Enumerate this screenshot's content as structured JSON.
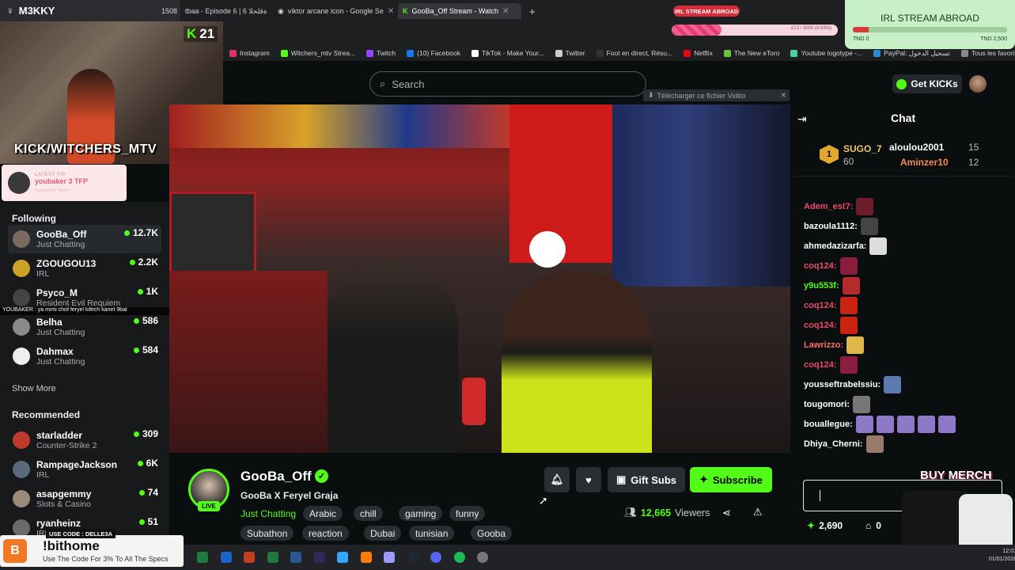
{
  "app": {
    "title": "M3KKY",
    "tab_count": "1508"
  },
  "tabs": [
    {
      "label": "tbaa - Episode 6 | 6 ةقلحلا"
    },
    {
      "label": "viktor arcane icon - Google Se"
    },
    {
      "label": "GooBa_Off Stream - Watch"
    }
  ],
  "irl": {
    "badge": "IRL STREAM ABROAD",
    "progress_text": "£13 / 3000 (9.63%)",
    "box_title": "IRL STREAM ABROAD",
    "left": "TND 0",
    "right": "TND 2,500",
    "progress_fraction": 0.3,
    "box_fraction": 0.1
  },
  "bookmarks": [
    {
      "label": "Instagram",
      "color": "#e1306c"
    },
    {
      "label": "Witchers_mtv Strea...",
      "color": "#53fc18"
    },
    {
      "label": "Twitch",
      "color": "#9146ff"
    },
    {
      "label": "(10) Facebook",
      "color": "#1877f2"
    },
    {
      "label": "TikTok - Make Your...",
      "color": "#ffffff"
    },
    {
      "label": "Twitter",
      "color": "#cccccc"
    },
    {
      "label": "Foot en direct, Résu...",
      "color": "#333333"
    },
    {
      "label": "Netflix",
      "color": "#e50914"
    },
    {
      "label": "The New eToro",
      "color": "#69c53e"
    },
    {
      "label": "Youtube logotype -...",
      "color": "#4ad29a"
    },
    {
      "label": "PayPal: تسجيل الدخول",
      "color": "#2c8bd6"
    },
    {
      "label": "Tous les favoris",
      "color": "#888888"
    }
  ],
  "webcam": {
    "overlay_text": "KICK/WITCHERS_MTV",
    "kick_count": "21"
  },
  "tip": {
    "label": "LATEST TIP",
    "value": "youbaker 3 TFP",
    "small": "Powered by Tipeee"
  },
  "ticker": {
    "text": "YOUBAKER : ya mimi chof feryel kifech kanet 9bal"
  },
  "search": {
    "placeholder": "Search"
  },
  "header": {
    "get_kicks": "Get KICKs"
  },
  "download_bar": {
    "label": "Télécharger ce fichier Vidéo"
  },
  "sidebar": {
    "following_label": "Following",
    "following": [
      {
        "name": "GooBa_Off",
        "category": "Just Chatting",
        "viewers": "12.7K",
        "avatar": "#7a6a60"
      },
      {
        "name": "ZGOUGOU13",
        "category": "IRL",
        "viewers": "2.2K",
        "avatar": "#c9a227"
      },
      {
        "name": "Psyco_M",
        "category": "Resident Evil Requiem",
        "viewers": "1K",
        "avatar": "#444444"
      },
      {
        "name": "Belha",
        "category": "Just Chatting",
        "viewers": "586",
        "avatar": "#8a8a8a"
      },
      {
        "name": "Dahmax",
        "category": "Just Chatting",
        "viewers": "584",
        "avatar": "#eeeeee"
      }
    ],
    "show_more": "Show More",
    "recommended_label": "Recommended",
    "recommended": [
      {
        "name": "starladder",
        "category": "Counter-Strike 2",
        "viewers": "309",
        "avatar": "#c0392b"
      },
      {
        "name": "RampageJackson",
        "category": "IRL",
        "viewers": "6K",
        "avatar": "#5a6a7a"
      },
      {
        "name": "asapgemmy",
        "category": "Slots & Casino",
        "viewers": "74",
        "avatar": "#9a8a7a"
      },
      {
        "name": "ryanheinz",
        "category": "IRL",
        "viewers": "51",
        "avatar": "#6a6a6a"
      }
    ]
  },
  "stream": {
    "name": "GooBa_Off",
    "live": "LIVE",
    "title": "GooBa X Feryel Graja",
    "category": "Just Chatting",
    "tags_row1": [
      "Arabic",
      "chill",
      "gaming",
      "funny"
    ],
    "tags_row2": [
      "Subathon",
      "reaction",
      "Dubai",
      "tunisian",
      "Gooba"
    ],
    "gift_subs": "Gift Subs",
    "subscribe": "Subscribe",
    "viewers": "12,665",
    "viewers_label": "Viewers"
  },
  "chat": {
    "title": "Chat",
    "leaders": [
      {
        "name": "SUGO_7",
        "value": "60"
      },
      {
        "name": "aloulou2001",
        "value": "15"
      },
      {
        "name": "Aminzer10",
        "value": "12"
      }
    ],
    "messages": [
      {
        "user": "Adem_est7:",
        "color": "#e94b6a"
      },
      {
        "user": "bazoula1112:",
        "color": "#ffffff"
      },
      {
        "user": "ahmedazizarfa:",
        "color": "#ffffff"
      },
      {
        "user": "coq124:",
        "color": "#e94b6a"
      },
      {
        "user": "y9u553f:",
        "color": "#53fc18"
      },
      {
        "user": "coq124:",
        "color": "#e94b6a"
      },
      {
        "user": "coq124:",
        "color": "#e94b6a"
      },
      {
        "user": "Lawrizzo:",
        "color": "#ff6b6b"
      },
      {
        "user": "coq124:",
        "color": "#e94b6a"
      },
      {
        "user": "yousseftrabelssiu:",
        "color": "#ffffff"
      },
      {
        "user": "tougomori:",
        "color": "#ffffff"
      },
      {
        "user": "bouallegue:",
        "color": "#ffffff"
      },
      {
        "user": "Dhiya_Cherni:",
        "color": "#ffffff"
      }
    ],
    "points": "2,690",
    "points2": "0",
    "merch": "BUY MERCH"
  },
  "promo": {
    "code": "USE CODE : DELLE3A",
    "name": "!bithome",
    "sub": "Use The Code For 3% To All The Specs",
    "logo": "B"
  },
  "clock": {
    "time": "12:01",
    "date": "01/01/2026"
  },
  "colors": {
    "accent": "#53fc18",
    "bg": "#0b0e0f",
    "panel": "#18191b"
  }
}
